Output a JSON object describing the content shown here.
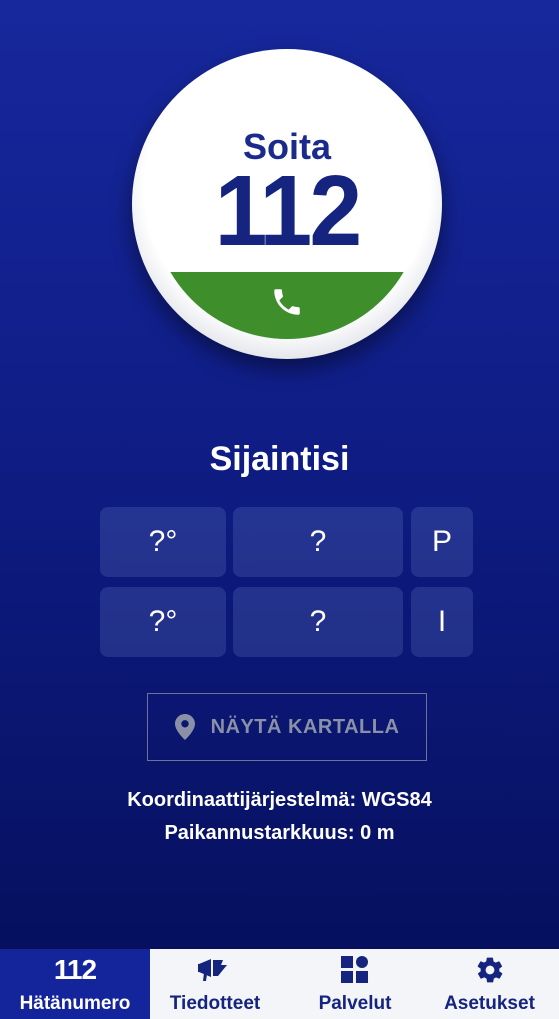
{
  "call_button": {
    "label": "Soita",
    "number": "112",
    "icon": "phone-icon",
    "colors": {
      "green": "#3e8e2c",
      "navy": "#14247f"
    }
  },
  "location": {
    "title": "Sijaintisi",
    "latitude_degrees": "?°",
    "latitude_minutes": "?",
    "latitude_dir": "P",
    "longitude_degrees": "?°",
    "longitude_minutes": "?",
    "longitude_dir": "I",
    "map_button_label": "NÄYTÄ KARTALLA",
    "map_button_icon": "map-pin-icon",
    "coordinate_system": "Koordinaattijärjestelmä: WGS84",
    "accuracy": "Paikannustarkkuus: 0 m"
  },
  "nav": {
    "items": [
      {
        "label": "Hätänumero",
        "icon_text": "112",
        "icon": "emergency-number-icon",
        "active": true
      },
      {
        "label": "Tiedotteet",
        "icon": "megaphone-icon",
        "active": false
      },
      {
        "label": "Palvelut",
        "icon": "services-grid-icon",
        "active": false
      },
      {
        "label": "Asetukset",
        "icon": "gear-icon",
        "active": false
      }
    ]
  },
  "theme": {
    "background_top": "#17289d",
    "background_bottom": "#06105f",
    "active_tab": "#14249a"
  }
}
